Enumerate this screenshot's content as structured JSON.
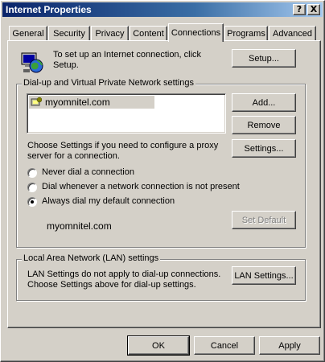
{
  "window": {
    "title": "Internet Properties"
  },
  "title_buttons": {
    "help": "?",
    "close": "X"
  },
  "tabs": [
    {
      "label": "General"
    },
    {
      "label": "Security"
    },
    {
      "label": "Privacy"
    },
    {
      "label": "Content"
    },
    {
      "label": "Connections"
    },
    {
      "label": "Programs"
    },
    {
      "label": "Advanced"
    }
  ],
  "active_tab": "Connections",
  "setup": {
    "text": "To set up an Internet connection, click Setup.",
    "button": "Setup..."
  },
  "dialup": {
    "group_label": "Dial-up and Virtual Private Network settings",
    "list_items": [
      "myomnitel.com"
    ],
    "add_button": "Add...",
    "remove_button": "Remove",
    "settings_text": "Choose Settings if you need to configure a proxy server for a connection.",
    "settings_button": "Settings...",
    "radios": [
      {
        "label": "Never dial a connection",
        "checked": false
      },
      {
        "label": "Dial whenever a network connection is not present",
        "checked": false
      },
      {
        "label": "Always dial my default connection",
        "checked": true
      }
    ],
    "current_default": "myomnitel.com",
    "set_default_button": "Set Default"
  },
  "lan": {
    "group_label": "Local Area Network (LAN) settings",
    "text": "LAN Settings do not apply to dial-up connections. Choose Settings above for dial-up settings.",
    "button": "LAN Settings..."
  },
  "footer": {
    "ok": "OK",
    "cancel": "Cancel",
    "apply": "Apply"
  }
}
